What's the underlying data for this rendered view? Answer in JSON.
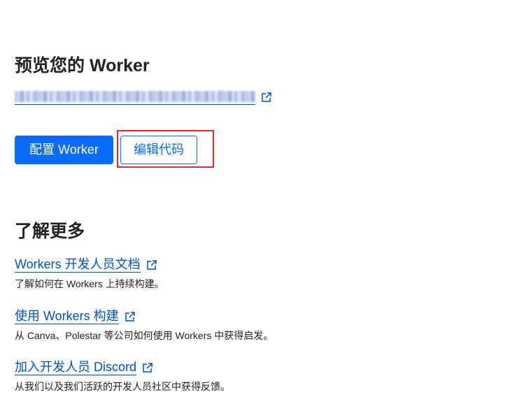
{
  "preview": {
    "title": "预览您的 Worker",
    "url_redacted": ""
  },
  "actions": {
    "configure_label": "配置 Worker",
    "edit_code_label": "编辑代码"
  },
  "learn_more": {
    "title": "了解更多",
    "resources": [
      {
        "link": "Workers 开发人员文档",
        "description": "了解如何在 Workers 上持续构建。"
      },
      {
        "link": "使用 Workers 构建",
        "description": "从 Canva、Polestar 等公司如何使用 Workers 中获得启发。"
      },
      {
        "link": "加入开发人员 Discord",
        "description": "从我们以及我们活跃的开发人员社区中获得反馈。"
      }
    ]
  },
  "icons": {
    "external": "external-link-icon"
  },
  "colors": {
    "primary": "#0a6cff",
    "link": "#0051c3",
    "highlight": "#e3272e",
    "text": "#222222"
  }
}
